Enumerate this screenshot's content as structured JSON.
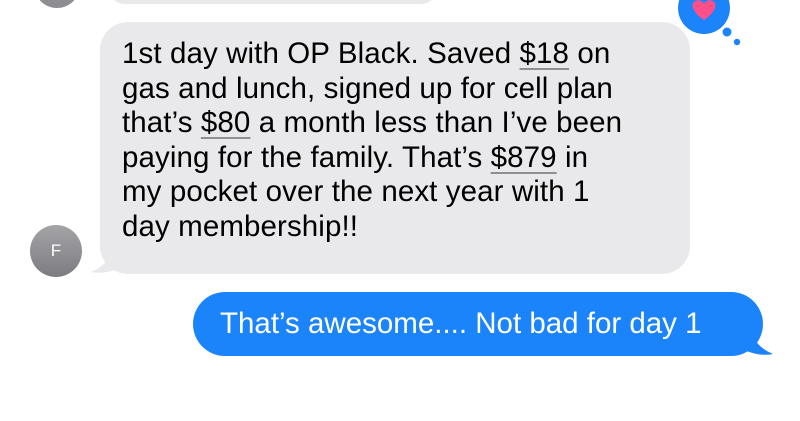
{
  "thread": {
    "received_message": {
      "sender_initial": "F",
      "line1_pre": "1st day with OP Black. Saved ",
      "amount1": "$18",
      "line1_post": " on",
      "line2": "gas and lunch, signed up for cell plan",
      "line3_pre": "that’s ",
      "amount2": "$80",
      "line3_post": " a month less than I’ve been",
      "line4_pre": "paying for the family. That’s ",
      "amount3": "$879",
      "line4_post": " in",
      "line5": "my pocket over the next year with 1",
      "line6": "day membership!!",
      "reaction_icon": "heart-icon",
      "bubble_color": "#e9e9eb"
    },
    "sent_message": {
      "text": "That’s awesome.... Not bad for day 1",
      "bubble_color": "#1b84fb"
    },
    "reaction_color": "#1b84fb",
    "heart_color": "#ff4f8b"
  }
}
